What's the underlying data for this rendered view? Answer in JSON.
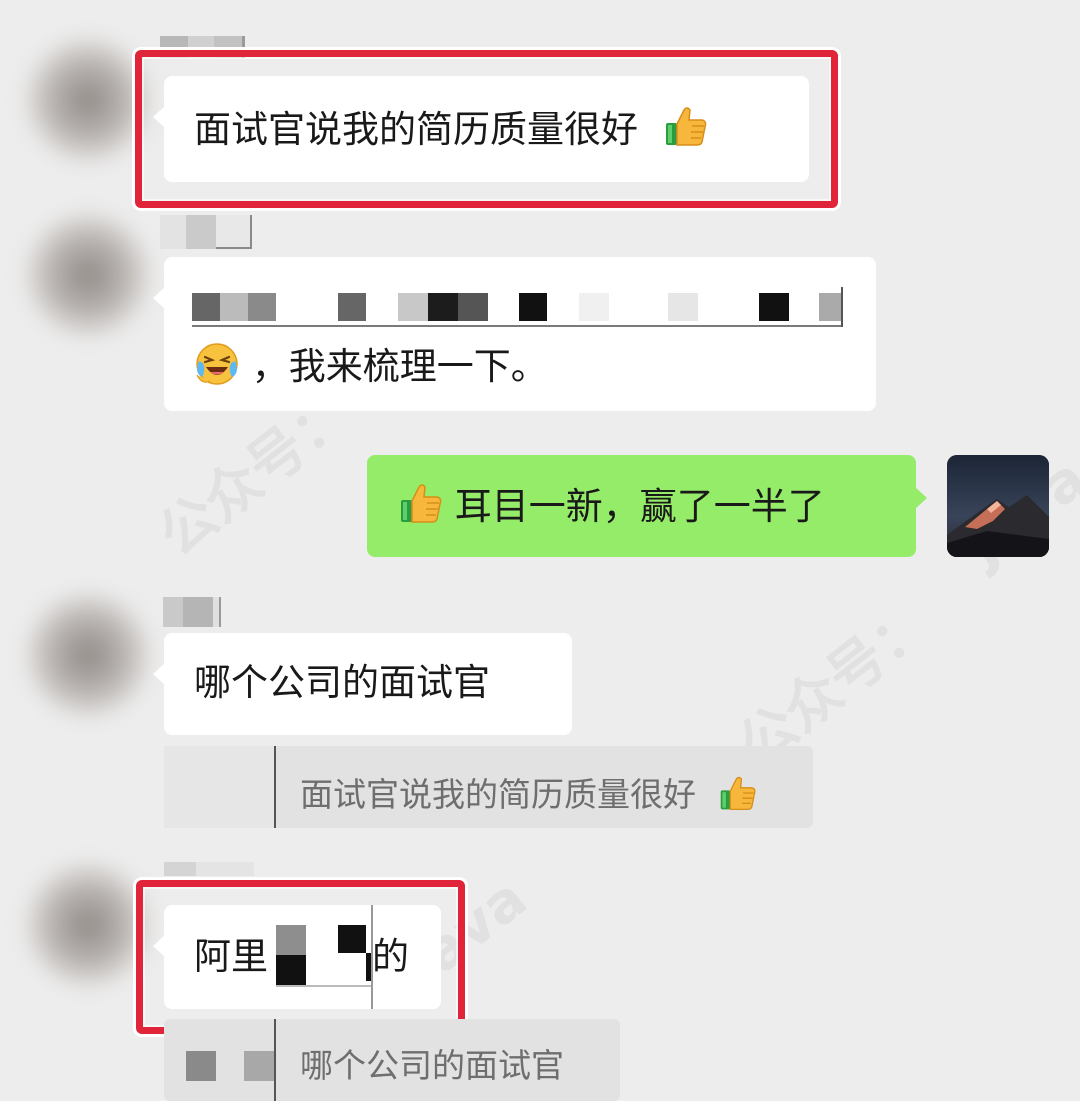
{
  "colors": {
    "background": "#ededed",
    "left_bubble": "#ffffff",
    "right_bubble": "#95ec69",
    "highlight_frame": "#e0243a",
    "quote_bg": "#e2e2e2"
  },
  "watermark": {
    "text_1": "公众号：",
    "text_2": "Java"
  },
  "messages": [
    {
      "side": "left",
      "text": "面试官说我的简历质量很好",
      "emoji": "thumbs-up-icon",
      "highlighted": true
    },
    {
      "side": "left",
      "emoji": "laughing-crying-icon",
      "text": "，我来梳理一下。",
      "redacted_line": true
    },
    {
      "side": "right",
      "emoji": "thumbs-up-icon",
      "text": "耳目一新，赢了一半了"
    },
    {
      "side": "left",
      "text": "哪个公司的面试官",
      "quote": {
        "text": "面试官说我的简历质量很好",
        "emoji": "thumbs-up-icon"
      }
    },
    {
      "side": "left",
      "text_prefix": "阿里",
      "text_suffix": "的",
      "highlighted": true,
      "quote": {
        "text": "哪个公司的面试官"
      }
    }
  ]
}
